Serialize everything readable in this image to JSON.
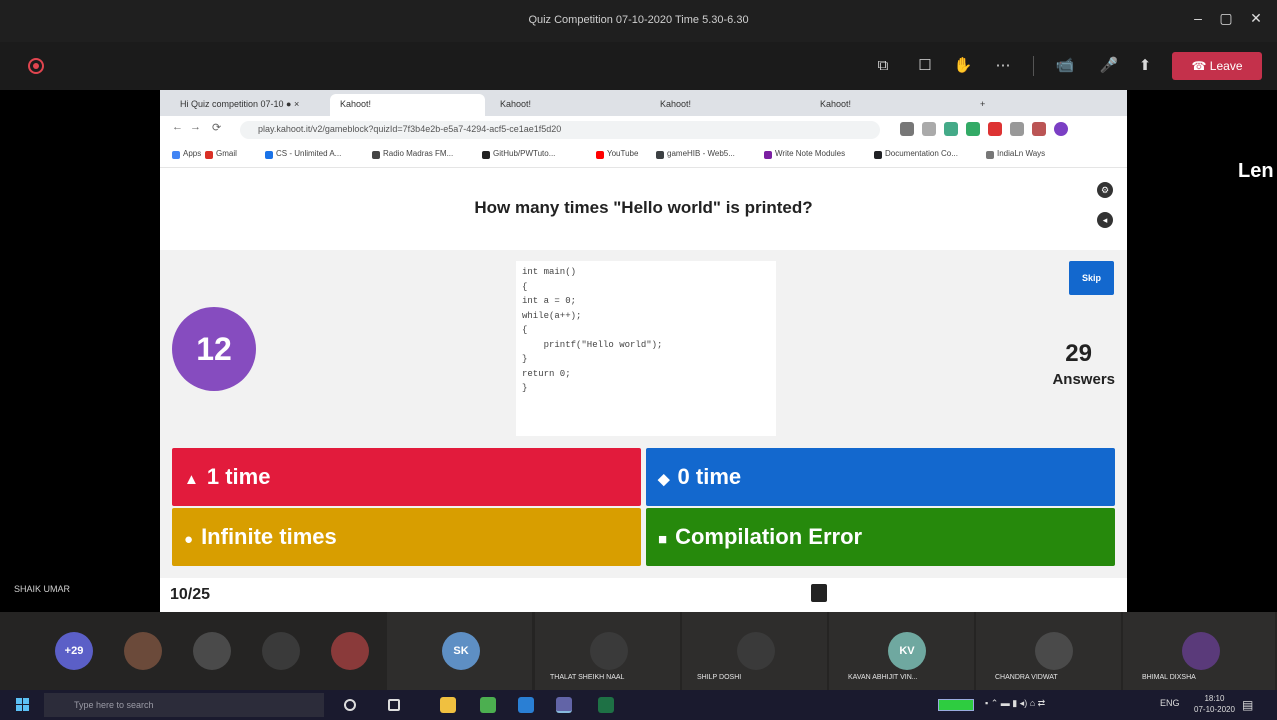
{
  "window": {
    "title": "Quiz Competition 07-10-2020 Time 5.30-6.30",
    "controls": [
      "–",
      "▢",
      "✕"
    ]
  },
  "meeting": {
    "recording_time": "",
    "control_icons": [
      "grid-view-icon",
      "chat-icon",
      "raise-hand-icon",
      "more-options-icon",
      "camera-icon",
      "microphone-icon",
      "share-icon"
    ],
    "control_glyphs": [
      "⧉",
      "☐",
      "✋",
      "⋯",
      "📹",
      "🎤",
      "⬆"
    ],
    "leave_label": "Leave",
    "leave_glyph": "☎"
  },
  "share": {
    "presenter_name": "SHAIK UMAR",
    "side_label": "Len"
  },
  "browser": {
    "tabs": [
      {
        "label": "Hi Quiz competition 07-10 ● ×"
      },
      {
        "label": "Kahoot!"
      },
      {
        "label": "Kahoot!"
      },
      {
        "label": "Kahoot!"
      },
      {
        "label": "Kahoot!"
      }
    ],
    "new_tab": "+",
    "url": "play.kahoot.it/v2/gameblock?quizId=7f3b4e2b-e5a7-4294-acf5-ce1ae1f5d20",
    "nav": {
      "back": "←",
      "forward": "→",
      "reload": "⟳",
      "home": "⌂"
    },
    "bookmarks": [
      "Apps",
      "Gmail",
      "CS - Unlimited A...",
      "Radio Madras FM...",
      "GitHub/PWTuto...",
      "YouTube",
      "gameHIB - Web5...",
      "Write Note Modules",
      "Documentation Co...",
      "IndiaLn Ways"
    ],
    "bookmark_colors": [
      "#4285f4",
      "#d93025",
      "#1a73e8",
      "#444",
      "#222",
      "#ff0000",
      "#3c4043",
      "#7b1fa2",
      "#202124",
      "#777"
    ]
  },
  "quiz": {
    "question": "How many times \"Hello world\" is printed?",
    "code_lines": [
      "int main()",
      "{",
      "int a = 0;",
      "while(a++);",
      "{",
      "    printf(\"Hello world\");",
      "}",
      "",
      "return 0;",
      "}"
    ],
    "timer": "12",
    "skip_label": "Skip",
    "answers_count": "29",
    "answers_label": "Answers",
    "options": [
      {
        "symbol": "▲",
        "text": "1 time",
        "color": "#e21b3c"
      },
      {
        "symbol": "◆",
        "text": "0 time",
        "color": "#1368ce"
      },
      {
        "symbol": "●",
        "text": "Infinite times",
        "color": "#d89e00"
      },
      {
        "symbol": "■",
        "text": "Compilation Error",
        "color": "#26890c"
      }
    ],
    "progress": "10/25",
    "accent": "#864cbf"
  },
  "participants": [
    {
      "initials": "+29",
      "name": "",
      "color": "#5b5fc7"
    },
    {
      "initials": "",
      "name": "",
      "color": "#6b4a3a"
    },
    {
      "initials": "",
      "name": "",
      "color": "#4a4a4a"
    },
    {
      "initials": "",
      "name": "",
      "color": "#3a3a3a"
    },
    {
      "initials": "",
      "name": "",
      "color": "#8a3a3a"
    },
    {
      "initials": "SK",
      "name": "",
      "color": "#5e8fc4"
    },
    {
      "initials": "",
      "name": "THALAT SHEIKH NAAL",
      "color": "#3a3a3a"
    },
    {
      "initials": "",
      "name": "SHILP DOSHI",
      "color": "#3a3a3a"
    },
    {
      "initials": "KV",
      "name": "KAVAN ABHIJIT VIN...",
      "color": "#6fa8a0"
    },
    {
      "initials": "",
      "name": "CHANDRA VIDWAT",
      "color": "#4a4a4a"
    },
    {
      "initials": "",
      "name": "BHIMAL DIXSHA",
      "color": "#5a3a7a"
    }
  ],
  "taskbar": {
    "search_placeholder": "Type here to search",
    "apps": [
      "cortana-icon",
      "task-view-icon",
      "file-explorer-icon",
      "chrome-icon",
      "vscode-icon",
      "teams-icon",
      "excel-icon"
    ],
    "app_colors": [
      "#ddd",
      "#ddd",
      "#f0c040",
      "#4caf50",
      "#2a7fd4",
      "#6264a7",
      "#1e7145"
    ],
    "tray_lang": "ENG",
    "clock_time": "18:10",
    "clock_date": "07-10-2020"
  }
}
